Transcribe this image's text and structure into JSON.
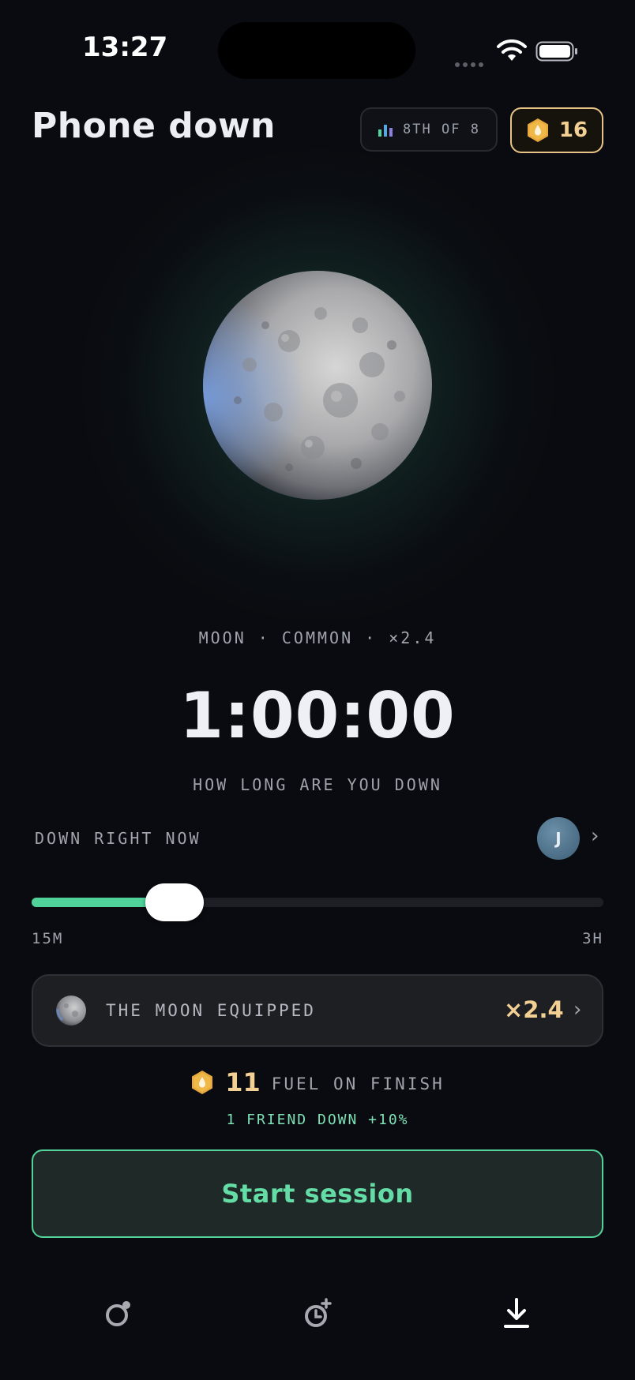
{
  "status_bar": {
    "time": "13:27"
  },
  "header": {
    "title": "Phone down",
    "rank": "8TH OF 8",
    "fuel_balance": "16"
  },
  "planet": {
    "info": "MOON · COMMON · ×2.4"
  },
  "session": {
    "timer": "1:00:00",
    "prompt": "HOW LONG ARE YOU DOWN",
    "down_label": "DOWN RIGHT NOW",
    "friend_initial": "J",
    "slider_min": "15M",
    "slider_max": "3H",
    "slider_value": 0.25
  },
  "equipped": {
    "label": "THE MOON EQUIPPED",
    "multiplier": "×2.4"
  },
  "fuel": {
    "amount": "11",
    "label": "FUEL ON FINISH",
    "friend_bonus": "1 FRIEND DOWN +10%"
  },
  "start_button": "Start session",
  "colors": {
    "accent_green": "#4fd39a",
    "gold": "#f2cf93",
    "background": "#0a0b10"
  },
  "nav": {
    "items": [
      {
        "icon": "planet-icon"
      },
      {
        "icon": "alarm-add-icon"
      },
      {
        "icon": "download-icon"
      }
    ]
  }
}
